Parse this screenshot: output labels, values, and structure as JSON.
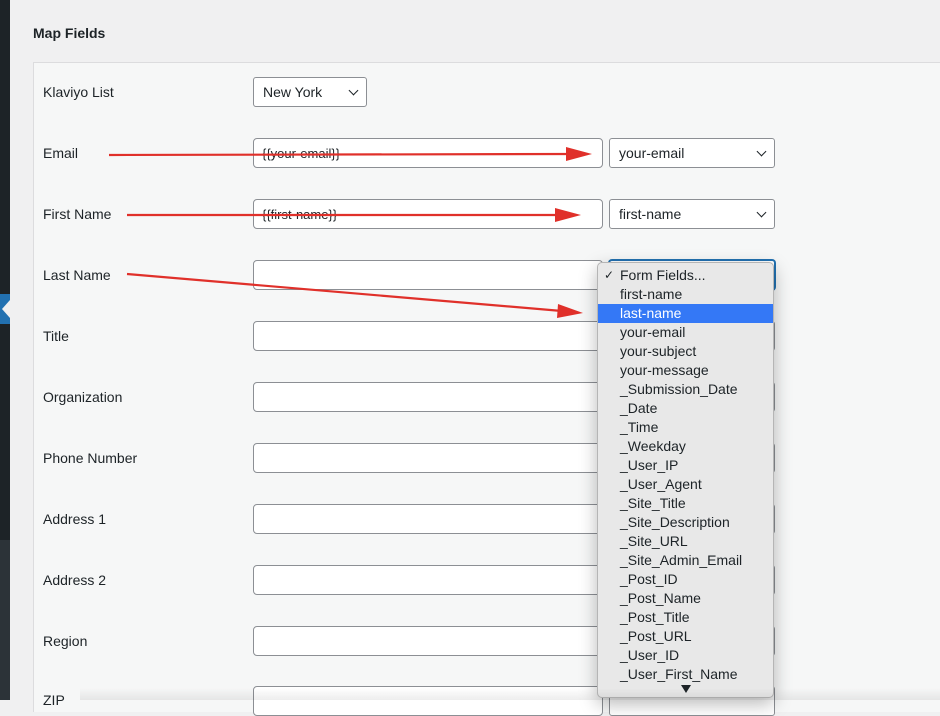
{
  "section_title": "Map Fields",
  "fields": [
    {
      "label": "Klaviyo List"
    },
    {
      "label": "Email",
      "value": "{{your-email}}",
      "select": "your-email"
    },
    {
      "label": "First Name",
      "value": "{{first-name}}",
      "select": "first-name"
    },
    {
      "label": "Last Name",
      "value": ""
    },
    {
      "label": "Title",
      "value": ""
    },
    {
      "label": "Organization",
      "value": ""
    },
    {
      "label": "Phone Number",
      "value": ""
    },
    {
      "label": "Address 1",
      "value": ""
    },
    {
      "label": "Address 2",
      "value": ""
    },
    {
      "label": "Region",
      "value": ""
    },
    {
      "label": "ZIP",
      "value": ""
    }
  ],
  "klaviyo_list_selected": "New York",
  "dropdown": {
    "checkmark": "✓",
    "checked_option": "Form Fields...",
    "highlighted_option": "last-name",
    "options": [
      "Form Fields...",
      "first-name",
      "last-name",
      "your-email",
      "your-subject",
      "your-message",
      "_Submission_Date",
      "_Date",
      "_Time",
      "_Weekday",
      "_User_IP",
      "_User_Agent",
      "_Site_Title",
      "_Site_Description",
      "_Site_URL",
      "_Site_Admin_Email",
      "_Post_ID",
      "_Post_Name",
      "_Post_Title",
      "_Post_URL",
      "_User_ID",
      "_User_First_Name"
    ],
    "scroll_indicator": "scroll-down-triangle-icon"
  },
  "annotation_color": "#e0302a",
  "highlight_color": "#3478f6"
}
